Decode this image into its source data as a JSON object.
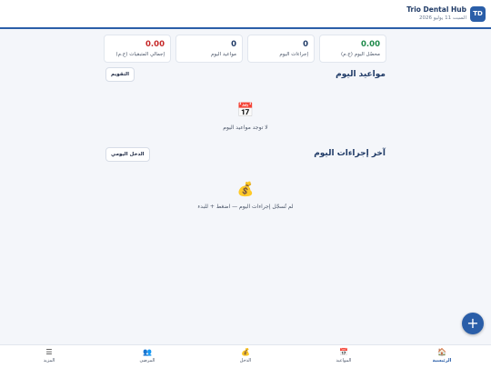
{
  "header": {
    "avatar": "TD",
    "title": "Trio Dental Hub",
    "date": "السبت 11 يوليو 2026"
  },
  "stats": [
    {
      "value": "0.00",
      "label": "محصّل اليوم (ج.م)",
      "color": "#1e8a4a"
    },
    {
      "value": "0",
      "label": "إجراءات اليوم",
      "color": "#1f3a66"
    },
    {
      "value": "0",
      "label": "مواعيد اليوم",
      "color": "#1f3a66"
    },
    {
      "value": "0.00",
      "label": "إجمالي المتبقيات (ج.م)",
      "color": "#c62828"
    }
  ],
  "appointments": {
    "title": "مواعيد اليوم",
    "button": "التقويم",
    "empty_icon": "calendar-icon",
    "empty_text": "لا توجد مواعيد اليوم"
  },
  "procedures": {
    "title": "آخر إجراءات اليوم",
    "button": "الدخل اليومي",
    "empty_icon": "money-bag-icon",
    "empty_text": "لم تُسجّل إجراءات اليوم — اضغط + للبدء"
  },
  "fab": {
    "label": "+"
  },
  "nav": [
    {
      "label": "الرئيسية",
      "icon": "home-icon",
      "glyph": "🏠",
      "active": true
    },
    {
      "label": "المواعيد",
      "icon": "calendar-icon",
      "glyph": "📅",
      "active": false
    },
    {
      "label": "الدخل",
      "icon": "money-bag-icon",
      "glyph": "💰",
      "active": false
    },
    {
      "label": "المرضى",
      "icon": "patients-icon",
      "glyph": "👥",
      "active": false
    },
    {
      "label": "المزيد",
      "icon": "menu-icon",
      "glyph": "☰",
      "active": false
    }
  ]
}
